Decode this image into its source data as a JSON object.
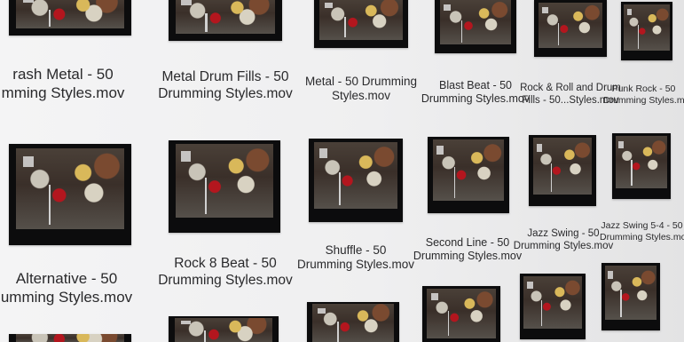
{
  "files": [
    {
      "line1": "rash Metal - 50",
      "line2": "mming Styles.mov"
    },
    {
      "line1": "Metal Drum Fills - 50",
      "line2": "Drumming Styles.mov"
    },
    {
      "line1": "Metal - 50 Drumming",
      "line2": "Styles.mov"
    },
    {
      "line1": "Blast Beat - 50",
      "line2": "Drumming Styles.mov"
    },
    {
      "line1": "Rock & Roll and Drum",
      "line2": "Fills - 50...Styles.mov"
    },
    {
      "line1": "Punk Rock - 50",
      "line2": "Drumming Styles.mov"
    },
    {
      "line1": "Alternative - 50",
      "line2": "umming Styles.mov"
    },
    {
      "line1": "Rock 8 Beat - 50",
      "line2": "Drumming Styles.mov"
    },
    {
      "line1": "Shuffle - 50",
      "line2": "Drumming Styles.mov"
    },
    {
      "line1": "Second Line - 50",
      "line2": "Drumming Styles.mov"
    },
    {
      "line1": "Jazz Swing - 50",
      "line2": "Drumming Styles.mov"
    },
    {
      "line1": "Jazz Swing 5-4 - 50",
      "line2": "Drumming Styles.mov"
    }
  ]
}
